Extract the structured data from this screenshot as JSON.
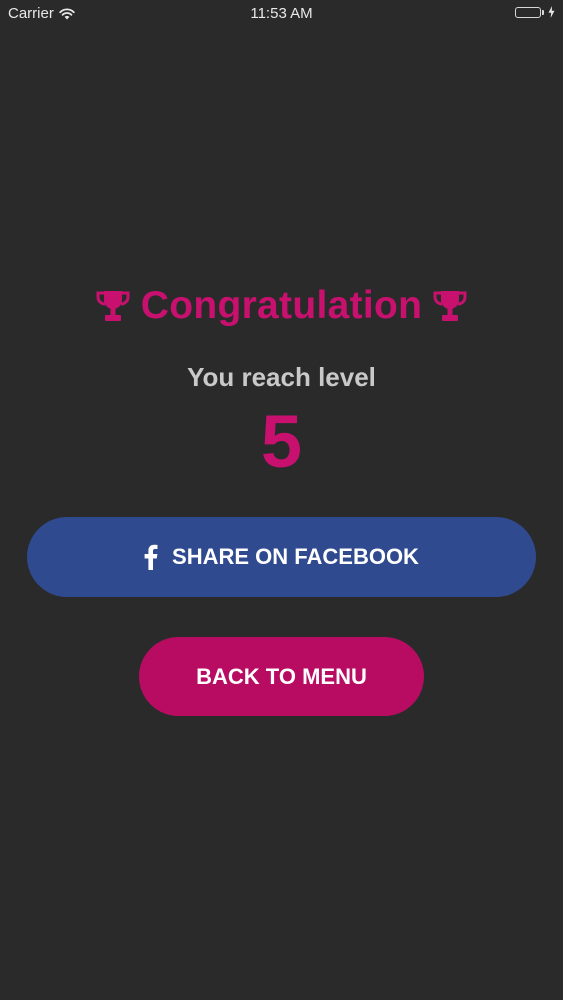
{
  "status_bar": {
    "carrier": "Carrier",
    "time": "11:53 AM",
    "battery_color": "#4cd964",
    "icons": [
      "wifi-icon",
      "battery-icon",
      "charging-icon"
    ]
  },
  "result": {
    "title": "Congratulation",
    "title_icon": "trophy-icon",
    "subtitle": "You reach level",
    "level": "5"
  },
  "actions": {
    "share_label": "SHARE ON FACEBOOK",
    "share_icon": "facebook-icon",
    "menu_label": "BACK TO MENU"
  },
  "colors": {
    "background": "#2a2a2b",
    "accent": "#c8106e",
    "facebook": "#2f4a8e",
    "menu_button": "#b80c63",
    "subtitle": "#c9c9c9"
  }
}
